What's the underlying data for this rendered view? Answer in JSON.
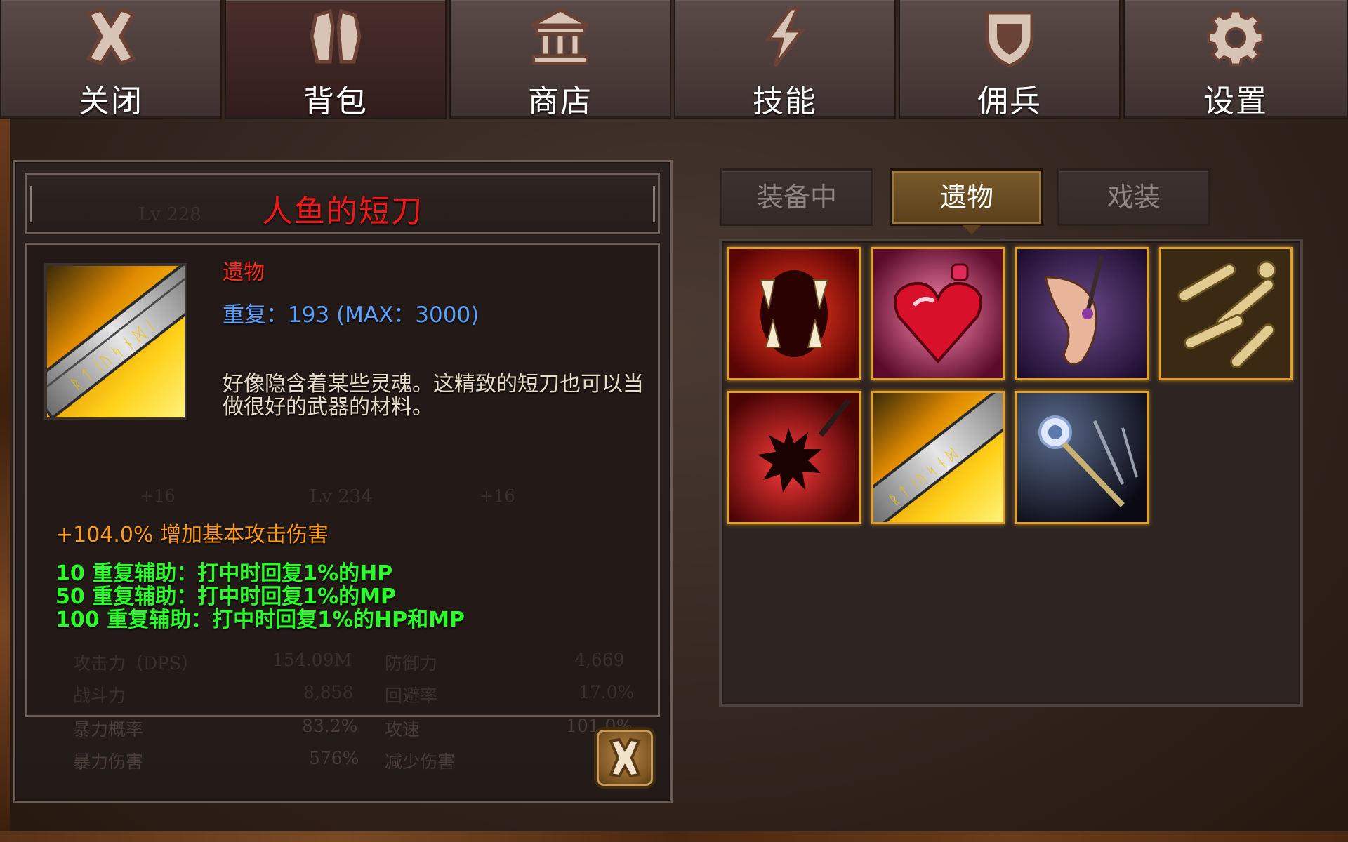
{
  "nav": {
    "tabs": [
      {
        "label": "关闭",
        "icon": "close-x-icon"
      },
      {
        "label": "背包",
        "icon": "bag-icon"
      },
      {
        "label": "商店",
        "icon": "shop-building-icon"
      },
      {
        "label": "技能",
        "icon": "lightning-icon"
      },
      {
        "label": "佣兵",
        "icon": "shield-icon"
      },
      {
        "label": "设置",
        "icon": "gear-icon"
      }
    ],
    "active_index": 1
  },
  "item": {
    "name": "人鱼的短刀",
    "type": "遗物",
    "repeat": "重复：193 (MAX：3000)",
    "description": "好像隐含着某些灵魂。这精致的短刀也可以当做很好的武器的材料。",
    "main_stat": "+104.0% 增加基本攻击伤害",
    "bonuses": [
      "10 重复辅助：打中时回复1%的HP",
      "50 重复辅助：打中时回复1%的MP",
      "100 重复辅助：打中时回复1%的HP和MP"
    ],
    "name_color": "#f01818",
    "type_color": "#ff2a1a",
    "repeat_color": "#5aa0ff",
    "main_stat_color": "#ff9a1a",
    "bonus_color": "#2aff2a"
  },
  "background_ghost": {
    "level_a": "Lv 228",
    "level_b": "Lv 234",
    "plus_a": "+16",
    "plus_b": "+16",
    "stats": [
      {
        "label": "攻击力（DPS）",
        "value": "154.09M",
        "label2": "防御力",
        "value2": "4,669"
      },
      {
        "label": "战斗力",
        "value": "8,858",
        "label2": "回避率",
        "value2": "17.0%"
      },
      {
        "label": "暴力概率",
        "value": "83.2%",
        "label2": "攻速",
        "value2": "101.0%"
      },
      {
        "label": "暴力伤害",
        "value": "576%",
        "label2": "减少伤害",
        "value2": ""
      }
    ]
  },
  "inventory": {
    "subtabs": [
      "装备中",
      "遗物",
      "戏装"
    ],
    "active_subtab": 1,
    "slots": [
      {
        "icon": "fangs-mouth-icon"
      },
      {
        "icon": "heart-potion-icon"
      },
      {
        "icon": "elf-ear-icon"
      },
      {
        "icon": "bones-icon"
      },
      {
        "icon": "spiked-flail-icon"
      },
      {
        "icon": "mermaid-dagger-icon"
      },
      {
        "icon": "magic-staff-icon"
      }
    ]
  }
}
